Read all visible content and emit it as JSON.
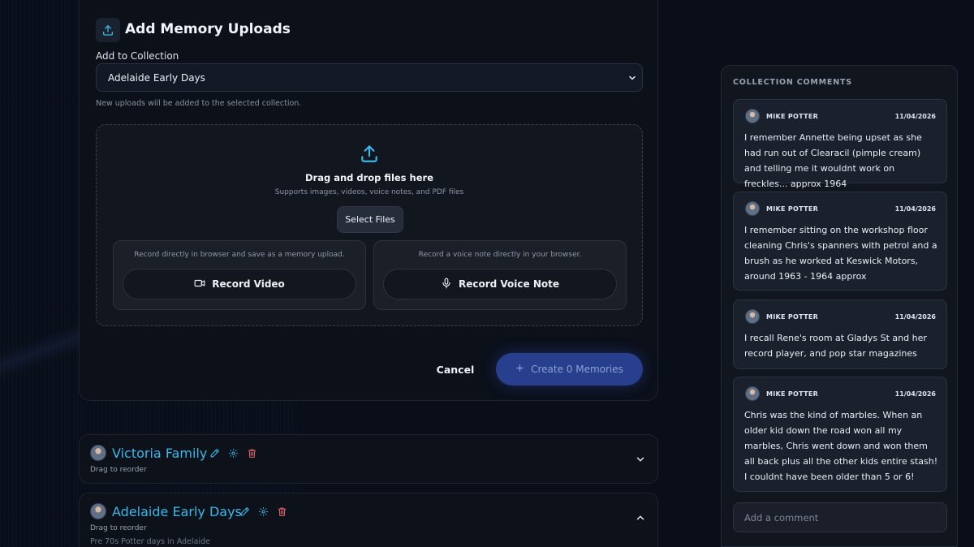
{
  "upload": {
    "title": "Add Memory Uploads",
    "collection_label": "Add to Collection",
    "collection_selected": "Adelaide Early Days",
    "collection_hint": "New uploads will be added to the selected collection.",
    "dropzone_title": "Drag and drop files here",
    "dropzone_sub": "Supports images, videos, voice notes, and PDF files",
    "select_files": "Select Files",
    "video_caption": "Record directly in browser and save as a memory upload.",
    "video_button": "Record Video",
    "voice_caption": "Record a voice note directly in your browser.",
    "voice_button": "Record Voice Note",
    "cancel": "Cancel",
    "create": "Create 0 Memories"
  },
  "collections": [
    {
      "title": "Victoria Family",
      "hint": "Drag to reorder"
    },
    {
      "title": "Adelaide Early Days",
      "hint": "Drag to reorder",
      "description": "Pre 70s Potter days in Adelaide"
    }
  ],
  "comments": {
    "heading": "COLLECTION COMMENTS",
    "items": [
      {
        "author": "MIKE POTTER",
        "date": "11/04/2026",
        "text": "I remember Annette being upset as she had run out of Clearacil (pimple cream) and telling me it wouldnt work on freckles... approx 1964"
      },
      {
        "author": "MIKE POTTER",
        "date": "11/04/2026",
        "text": "I remember sitting on the workshop floor cleaning Chris's spanners with petrol and a brush as he worked at Keswick Motors, around 1963 - 1964 approx"
      },
      {
        "author": "MIKE POTTER",
        "date": "11/04/2026",
        "text": "I recall Rene's room at Gladys St and her record player, and pop star magazines"
      },
      {
        "author": "MIKE POTTER",
        "date": "11/04/2026",
        "text": "Chris was the kind of marbles. When an older kid down the road won all my marbles, Chris went down and won them all back plus all the other kids entire stash! I couldnt have been older than 5 or 6!"
      }
    ],
    "input_placeholder": "Add a comment"
  },
  "colors": {
    "accent": "#39b8ea",
    "primary_button": "#283f8e",
    "delete_icon": "#e0626a"
  },
  "icons": {
    "upload": "upload-icon",
    "video": "video-camera-icon",
    "mic": "microphone-icon",
    "edit": "pencil-icon",
    "settings": "gear-icon",
    "delete": "trash-icon"
  }
}
